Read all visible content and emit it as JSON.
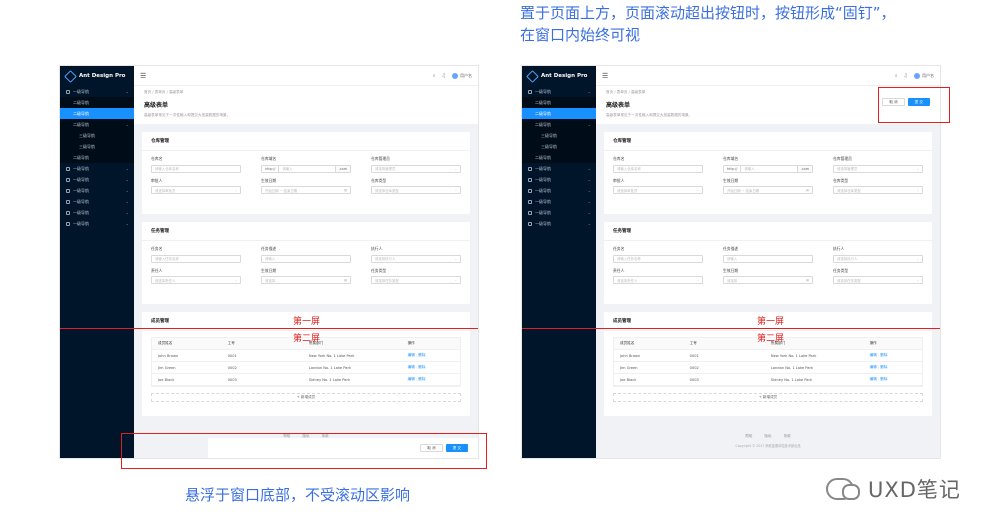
{
  "captions": {
    "top_line1": "置于页面上方，页面滚动超出按钮时，按钮形成“固钉”，",
    "top_line2": "在窗口内始终可视",
    "bottom": "悬浮于窗口底部，不受滚动区影响"
  },
  "watermark": "UXD笔记",
  "app": {
    "logo": "Ant Design Pro",
    "user": "用户名"
  },
  "sidebar": {
    "items": [
      {
        "label": "一级导航",
        "level": 1,
        "active": false
      },
      {
        "label": "二级导航",
        "level": 2,
        "active": false
      },
      {
        "label": "二级导航",
        "level": 2,
        "active": true
      },
      {
        "label": "二级导航",
        "level": 2,
        "active": false
      },
      {
        "label": "三级导航",
        "level": 3,
        "active": false
      },
      {
        "label": "三级导航",
        "level": 3,
        "active": false
      },
      {
        "label": "二级导航",
        "level": 2,
        "active": false
      },
      {
        "label": "一级导航",
        "level": 1,
        "active": false
      },
      {
        "label": "一级导航",
        "level": 1,
        "active": false
      },
      {
        "label": "一级导航",
        "level": 1,
        "active": false
      },
      {
        "label": "一级导航",
        "level": 1,
        "active": false
      },
      {
        "label": "一级导航",
        "level": 1,
        "active": false
      },
      {
        "label": "一级导航",
        "level": 1,
        "active": false
      }
    ]
  },
  "page": {
    "breadcrumb": "首页 / 表单页 / 高级表单",
    "title": "高级表单",
    "desc": "高级表单常见于一次性输入和提交大批量数据的场景。"
  },
  "buttons": {
    "cancel": "取 消",
    "submit": "提 交"
  },
  "warehouse": {
    "title": "仓库管理",
    "fields": [
      {
        "label": "仓库名",
        "placeholder": "请输入仓库名称",
        "type": "text"
      },
      {
        "label": "仓库域名",
        "prefix": "http://",
        "placeholder": "请输入",
        "suffix": ".com",
        "type": "addon"
      },
      {
        "label": "仓库管理员",
        "placeholder": "请选择管理员",
        "type": "select"
      },
      {
        "label": "审批人",
        "placeholder": "请选择审批员",
        "type": "select"
      },
      {
        "label": "生效日期",
        "placeholder": "开始日期 ~ 结束日期",
        "type": "date"
      },
      {
        "label": "仓库类型",
        "placeholder": "请选择仓库类型",
        "type": "select"
      }
    ]
  },
  "task": {
    "title": "任务管理",
    "fields": [
      {
        "label": "任务名",
        "placeholder": "请输入任务名称",
        "type": "text"
      },
      {
        "label": "任务描述",
        "placeholder": "请输入",
        "type": "text"
      },
      {
        "label": "执行人",
        "placeholder": "请选择执行人",
        "type": "select"
      },
      {
        "label": "责任人",
        "placeholder": "请选择责任人",
        "type": "select"
      },
      {
        "label": "生效日期",
        "placeholder": "请选择",
        "type": "date"
      },
      {
        "label": "任务类型",
        "placeholder": "请选择任务类型",
        "type": "select"
      }
    ]
  },
  "members": {
    "title": "成员管理",
    "columns": [
      "成员姓名",
      "工号",
      "所属部门",
      "操作"
    ],
    "rows": [
      {
        "name": "John Brown",
        "id": "0001",
        "dept": "New York No. 1 Lake Park",
        "edit": "编辑",
        "delete": "删除"
      },
      {
        "name": "Jim Green",
        "id": "0002",
        "dept": "London No. 1 Lake Park",
        "edit": "编辑",
        "delete": "删除"
      },
      {
        "name": "Joe Black",
        "id": "0003",
        "dept": "Sidney No. 1 Lake Park",
        "edit": "编辑",
        "delete": "删除"
      }
    ],
    "add": "+ 新增成员"
  },
  "footer": {
    "links": [
      "帮助",
      "隐私",
      "条款"
    ],
    "copyright": "Copyright © 2017 蚂蚁金服体验技术部出品"
  },
  "annotations": {
    "screen1": "第一屏",
    "screen2": "第二屏"
  },
  "colors": {
    "sidebar": "#001529",
    "primary": "#1890ff",
    "annotation": "#e02020",
    "caption": "#3b6fe0"
  }
}
